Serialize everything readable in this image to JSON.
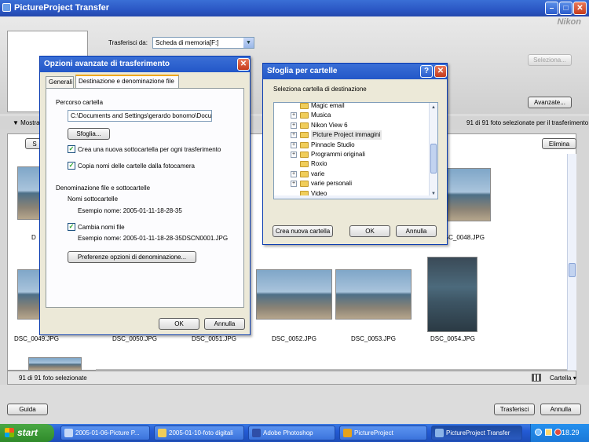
{
  "window": {
    "title": "PictureProject Transfer",
    "brand": "Nikon"
  },
  "top": {
    "transfer_from_label": "Trasferisci da:",
    "transfer_from_value": "Scheda di memoria[F:]",
    "select_button": "Seleziona...",
    "advanced_button": "Avanzate...",
    "show_label": "Mostra",
    "selected_summary": "91 di 91 foto selezionate per il trasferimento"
  },
  "gallery": {
    "left_button": "S",
    "delete_button": "Elimina",
    "partial_captions": [
      "D",
      "D"
    ],
    "thumbs": [
      {
        "caption": "DSC_0048.JPG"
      },
      {
        "caption": "DSC_0049.JPG"
      },
      {
        "caption": "DSC_0050.JPG"
      },
      {
        "caption": "DSC_0051.JPG"
      },
      {
        "caption": "DSC_0052.JPG"
      },
      {
        "caption": "DSC_0053.JPG"
      },
      {
        "caption": "DSC_0054.JPG"
      }
    ]
  },
  "status": {
    "count": "91 di 91 foto selezionate",
    "view_label": "Cartella"
  },
  "bottom": {
    "help_button": "Guida",
    "transfer_button": "Trasferisci",
    "cancel_button": "Annulla"
  },
  "options_dialog": {
    "title": "Opzioni avanzate di trasferimento",
    "tabs": [
      "Generali",
      "Destinazione e denominazione file"
    ],
    "folder_path_label": "Percorso cartella",
    "folder_path_value": "C:\\Documents and Settings\\gerardo bonomo\\Docu",
    "browse_button": "Sfoglia...",
    "create_subfolder": "Crea una nuova sottocartella per ogni trasferimento",
    "copy_folder_names": "Copia nomi delle cartelle dalla fotocamera",
    "naming_heading": "Denominazione file e sottocartelle",
    "subfolder_names_label": "Nomi sottocartelle",
    "subfolder_example": "Esempio nome: 2005-01-11-18-28-35",
    "rename_files": "Cambia nomi file",
    "file_example": "Esempio nome: 2005-01-11-18-28-35DSCN0001.JPG",
    "naming_prefs_button": "Preferenze opzioni di denominazione...",
    "ok_button": "OK",
    "cancel_button": "Annulla"
  },
  "folder_dialog": {
    "title": "Sfoglia per cartelle",
    "instruction": "Seleziona cartella di destinazione",
    "items": [
      {
        "name": "Magic email",
        "expander": false,
        "selected": false
      },
      {
        "name": "Musica",
        "expander": true,
        "selected": false
      },
      {
        "name": "Nikon View 6",
        "expander": true,
        "selected": false
      },
      {
        "name": "Picture Project immagini",
        "expander": true,
        "selected": true
      },
      {
        "name": "Pinnacle Studio",
        "expander": true,
        "selected": false
      },
      {
        "name": "Programmi originali",
        "expander": true,
        "selected": false
      },
      {
        "name": "Roxio",
        "expander": false,
        "selected": false
      },
      {
        "name": "varie",
        "expander": true,
        "selected": false
      },
      {
        "name": "varie personali",
        "expander": true,
        "selected": false
      },
      {
        "name": "Video",
        "expander": false,
        "selected": false
      }
    ],
    "new_folder_button": "Crea nuova cartella",
    "ok_button": "OK",
    "cancel_button": "Annulla"
  },
  "taskbar": {
    "start": "start",
    "tasks": [
      {
        "label": "2005-01-06-Picture P...",
        "active": false
      },
      {
        "label": "2005-01-10-foto digitali",
        "active": false
      },
      {
        "label": "Adobe Photoshop",
        "active": false
      },
      {
        "label": "PictureProject",
        "active": false
      },
      {
        "label": "PictureProject Transfer",
        "active": true
      }
    ],
    "clock": "18.29"
  }
}
